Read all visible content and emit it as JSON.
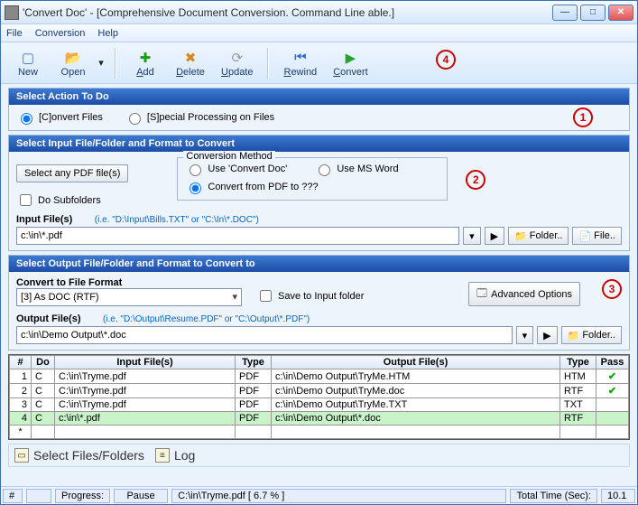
{
  "window": {
    "title": "'Convert Doc' - [Comprehensive Document Conversion. Command Line able.]"
  },
  "menu": {
    "file": "File",
    "conversion": "Conversion",
    "help": "Help"
  },
  "toolbar": {
    "new": "New",
    "open": "Open",
    "add": "Add",
    "delete": "Delete",
    "update": "Update",
    "rewind": "Rewind",
    "convert": "Convert"
  },
  "annotations": {
    "c1": "1",
    "c2": "2",
    "c3": "3",
    "c4": "4"
  },
  "p1": {
    "header": "Select Action To Do",
    "opt_convert": "[C]onvert Files",
    "opt_special": "[S]pecial Processing on Files"
  },
  "p2": {
    "header": "Select Input File/Folder and Format to Convert",
    "select_any": "Select any PDF file(s)",
    "do_sub": "Do Subfolders",
    "method_legend": "Conversion Method",
    "m_convertdoc": "Use 'Convert Doc'",
    "m_msword": "Use MS Word",
    "m_pdf": "Convert from PDF to ???",
    "input_label": "Input File(s)",
    "input_hint": "(i.e. \"D:\\Input\\Bills.TXT\"  or \"C:\\In\\*.DOC\")",
    "input_value": "c:\\in\\*.pdf",
    "folder_btn": "Folder..",
    "file_btn": "File.."
  },
  "p3": {
    "header": "Select Output File/Folder and Format to Convert to",
    "convert_to": "Convert to File Format",
    "convert_val": "[3] As DOC (RTF)",
    "save_input": "Save to Input folder",
    "advanced": "Advanced Options",
    "output_label": "Output File(s)",
    "output_hint": "(i.e. \"D:\\Output\\Resume.PDF\" or \"C:\\Output\\*.PDF\")",
    "output_value": "c:\\in\\Demo Output\\*.doc",
    "folder_btn": "Folder.."
  },
  "grid": {
    "h_num": "#",
    "h_do": "Do",
    "h_input": "Input File(s)",
    "h_type": "Type",
    "h_output": "Output File(s)",
    "h_type2": "Type",
    "h_pass": "Pass",
    "rows": [
      {
        "n": "1",
        "do": "C",
        "in": "C:\\in\\Tryme.pdf",
        "t": "PDF",
        "out": "c:\\in\\Demo Output\\TryMe.HTM",
        "t2": "HTM",
        "pass": "✔"
      },
      {
        "n": "2",
        "do": "C",
        "in": "C:\\in\\Tryme.pdf",
        "t": "PDF",
        "out": "c:\\in\\Demo Output\\TryMe.doc",
        "t2": "RTF",
        "pass": "✔"
      },
      {
        "n": "3",
        "do": "C",
        "in": "C:\\in\\Tryme.pdf",
        "t": "PDF",
        "out": "c:\\in\\Demo Output\\TryMe.TXT",
        "t2": "TXT",
        "pass": ""
      },
      {
        "n": "4",
        "do": "C",
        "in": "c:\\in\\*.pdf",
        "t": "PDF",
        "out": "c:\\in\\Demo Output\\*.doc",
        "t2": "RTF",
        "pass": ""
      }
    ],
    "star": "*"
  },
  "tabs": {
    "select": "Select Files/Folders",
    "log": "Log"
  },
  "status": {
    "hash": "#",
    "progress_lbl": "Progress:",
    "pause": "Pause",
    "file": "C:\\in\\Tryme.pdf   [ 6.7 % ]",
    "time_lbl": "Total Time (Sec):",
    "time_val": "10.1"
  }
}
